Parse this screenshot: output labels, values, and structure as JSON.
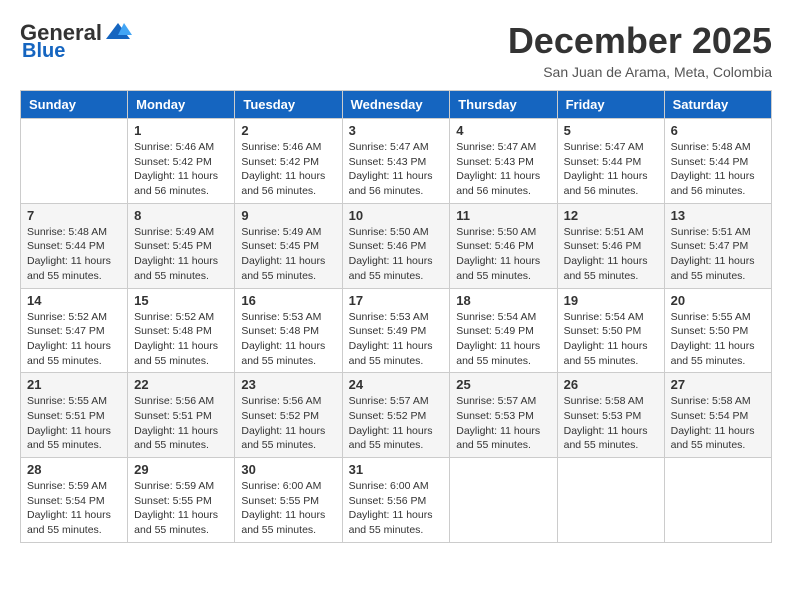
{
  "header": {
    "logo_general": "General",
    "logo_blue": "Blue",
    "month_title": "December 2025",
    "location": "San Juan de Arama, Meta, Colombia"
  },
  "columns": [
    "Sunday",
    "Monday",
    "Tuesday",
    "Wednesday",
    "Thursday",
    "Friday",
    "Saturday"
  ],
  "weeks": [
    [
      {
        "day": "",
        "sunrise": "",
        "sunset": "",
        "daylight": ""
      },
      {
        "day": "1",
        "sunrise": "Sunrise: 5:46 AM",
        "sunset": "Sunset: 5:42 PM",
        "daylight": "Daylight: 11 hours and 56 minutes."
      },
      {
        "day": "2",
        "sunrise": "Sunrise: 5:46 AM",
        "sunset": "Sunset: 5:42 PM",
        "daylight": "Daylight: 11 hours and 56 minutes."
      },
      {
        "day": "3",
        "sunrise": "Sunrise: 5:47 AM",
        "sunset": "Sunset: 5:43 PM",
        "daylight": "Daylight: 11 hours and 56 minutes."
      },
      {
        "day": "4",
        "sunrise": "Sunrise: 5:47 AM",
        "sunset": "Sunset: 5:43 PM",
        "daylight": "Daylight: 11 hours and 56 minutes."
      },
      {
        "day": "5",
        "sunrise": "Sunrise: 5:47 AM",
        "sunset": "Sunset: 5:44 PM",
        "daylight": "Daylight: 11 hours and 56 minutes."
      },
      {
        "day": "6",
        "sunrise": "Sunrise: 5:48 AM",
        "sunset": "Sunset: 5:44 PM",
        "daylight": "Daylight: 11 hours and 56 minutes."
      }
    ],
    [
      {
        "day": "7",
        "sunrise": "Sunrise: 5:48 AM",
        "sunset": "Sunset: 5:44 PM",
        "daylight": "Daylight: 11 hours and 55 minutes."
      },
      {
        "day": "8",
        "sunrise": "Sunrise: 5:49 AM",
        "sunset": "Sunset: 5:45 PM",
        "daylight": "Daylight: 11 hours and 55 minutes."
      },
      {
        "day": "9",
        "sunrise": "Sunrise: 5:49 AM",
        "sunset": "Sunset: 5:45 PM",
        "daylight": "Daylight: 11 hours and 55 minutes."
      },
      {
        "day": "10",
        "sunrise": "Sunrise: 5:50 AM",
        "sunset": "Sunset: 5:46 PM",
        "daylight": "Daylight: 11 hours and 55 minutes."
      },
      {
        "day": "11",
        "sunrise": "Sunrise: 5:50 AM",
        "sunset": "Sunset: 5:46 PM",
        "daylight": "Daylight: 11 hours and 55 minutes."
      },
      {
        "day": "12",
        "sunrise": "Sunrise: 5:51 AM",
        "sunset": "Sunset: 5:46 PM",
        "daylight": "Daylight: 11 hours and 55 minutes."
      },
      {
        "day": "13",
        "sunrise": "Sunrise: 5:51 AM",
        "sunset": "Sunset: 5:47 PM",
        "daylight": "Daylight: 11 hours and 55 minutes."
      }
    ],
    [
      {
        "day": "14",
        "sunrise": "Sunrise: 5:52 AM",
        "sunset": "Sunset: 5:47 PM",
        "daylight": "Daylight: 11 hours and 55 minutes."
      },
      {
        "day": "15",
        "sunrise": "Sunrise: 5:52 AM",
        "sunset": "Sunset: 5:48 PM",
        "daylight": "Daylight: 11 hours and 55 minutes."
      },
      {
        "day": "16",
        "sunrise": "Sunrise: 5:53 AM",
        "sunset": "Sunset: 5:48 PM",
        "daylight": "Daylight: 11 hours and 55 minutes."
      },
      {
        "day": "17",
        "sunrise": "Sunrise: 5:53 AM",
        "sunset": "Sunset: 5:49 PM",
        "daylight": "Daylight: 11 hours and 55 minutes."
      },
      {
        "day": "18",
        "sunrise": "Sunrise: 5:54 AM",
        "sunset": "Sunset: 5:49 PM",
        "daylight": "Daylight: 11 hours and 55 minutes."
      },
      {
        "day": "19",
        "sunrise": "Sunrise: 5:54 AM",
        "sunset": "Sunset: 5:50 PM",
        "daylight": "Daylight: 11 hours and 55 minutes."
      },
      {
        "day": "20",
        "sunrise": "Sunrise: 5:55 AM",
        "sunset": "Sunset: 5:50 PM",
        "daylight": "Daylight: 11 hours and 55 minutes."
      }
    ],
    [
      {
        "day": "21",
        "sunrise": "Sunrise: 5:55 AM",
        "sunset": "Sunset: 5:51 PM",
        "daylight": "Daylight: 11 hours and 55 minutes."
      },
      {
        "day": "22",
        "sunrise": "Sunrise: 5:56 AM",
        "sunset": "Sunset: 5:51 PM",
        "daylight": "Daylight: 11 hours and 55 minutes."
      },
      {
        "day": "23",
        "sunrise": "Sunrise: 5:56 AM",
        "sunset": "Sunset: 5:52 PM",
        "daylight": "Daylight: 11 hours and 55 minutes."
      },
      {
        "day": "24",
        "sunrise": "Sunrise: 5:57 AM",
        "sunset": "Sunset: 5:52 PM",
        "daylight": "Daylight: 11 hours and 55 minutes."
      },
      {
        "day": "25",
        "sunrise": "Sunrise: 5:57 AM",
        "sunset": "Sunset: 5:53 PM",
        "daylight": "Daylight: 11 hours and 55 minutes."
      },
      {
        "day": "26",
        "sunrise": "Sunrise: 5:58 AM",
        "sunset": "Sunset: 5:53 PM",
        "daylight": "Daylight: 11 hours and 55 minutes."
      },
      {
        "day": "27",
        "sunrise": "Sunrise: 5:58 AM",
        "sunset": "Sunset: 5:54 PM",
        "daylight": "Daylight: 11 hours and 55 minutes."
      }
    ],
    [
      {
        "day": "28",
        "sunrise": "Sunrise: 5:59 AM",
        "sunset": "Sunset: 5:54 PM",
        "daylight": "Daylight: 11 hours and 55 minutes."
      },
      {
        "day": "29",
        "sunrise": "Sunrise: 5:59 AM",
        "sunset": "Sunset: 5:55 PM",
        "daylight": "Daylight: 11 hours and 55 minutes."
      },
      {
        "day": "30",
        "sunrise": "Sunrise: 6:00 AM",
        "sunset": "Sunset: 5:55 PM",
        "daylight": "Daylight: 11 hours and 55 minutes."
      },
      {
        "day": "31",
        "sunrise": "Sunrise: 6:00 AM",
        "sunset": "Sunset: 5:56 PM",
        "daylight": "Daylight: 11 hours and 55 minutes."
      },
      {
        "day": "",
        "sunrise": "",
        "sunset": "",
        "daylight": ""
      },
      {
        "day": "",
        "sunrise": "",
        "sunset": "",
        "daylight": ""
      },
      {
        "day": "",
        "sunrise": "",
        "sunset": "",
        "daylight": ""
      }
    ]
  ]
}
